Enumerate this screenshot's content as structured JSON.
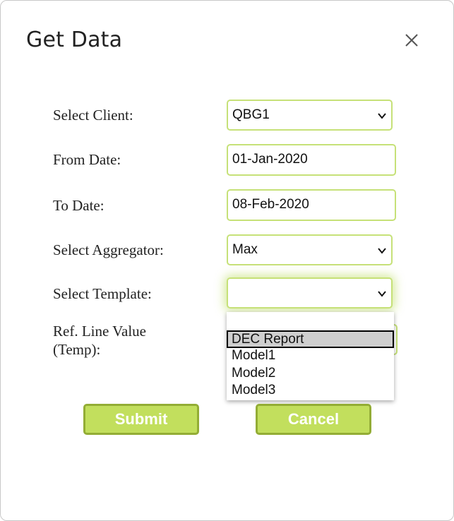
{
  "dialog": {
    "title": "Get Data"
  },
  "form": {
    "client": {
      "label": "Select Client:",
      "value": "QBG1"
    },
    "from_date": {
      "label": "From Date:",
      "value": "01-Jan-2020"
    },
    "to_date": {
      "label": "To Date:",
      "value": "08-Feb-2020"
    },
    "aggregator": {
      "label": "Select Aggregator:",
      "value": "Max"
    },
    "template": {
      "label": "Select Template:",
      "value": ""
    },
    "ref_line": {
      "label_line1": "Ref. Line Value",
      "label_line2": "(Temp):"
    }
  },
  "template_options": [
    "",
    "DEC Report",
    "Model1",
    "Model2",
    "Model3"
  ],
  "buttons": {
    "submit": "Submit",
    "cancel": "Cancel"
  },
  "colors": {
    "accent": "#c2df5d",
    "accent_border": "#93ad35",
    "field_border": "#c6e178"
  }
}
